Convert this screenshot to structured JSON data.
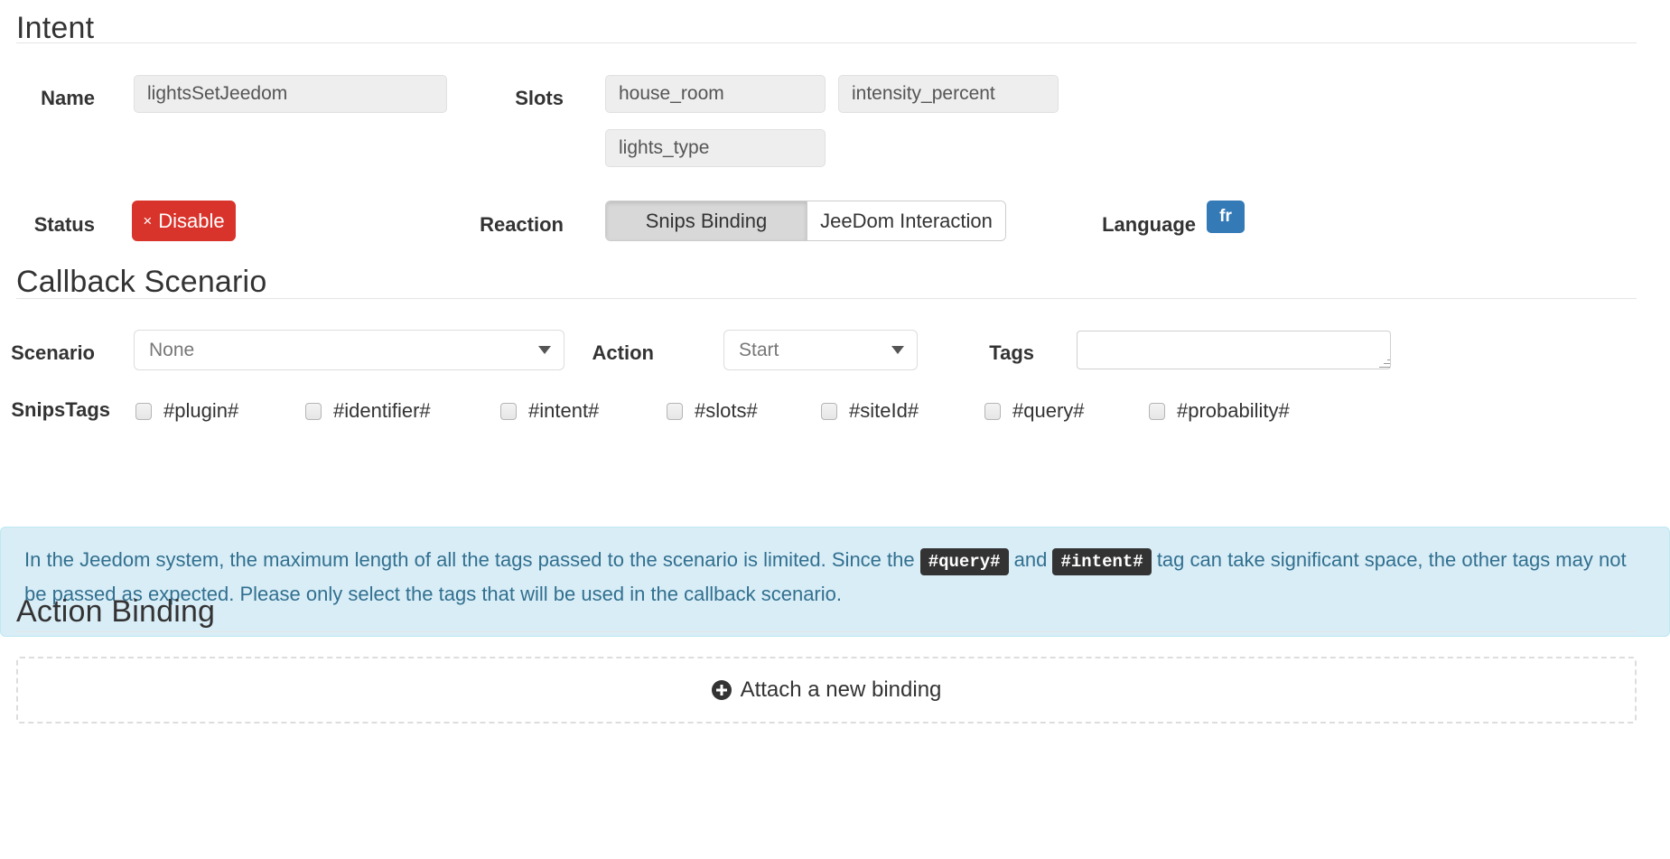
{
  "intent_section": {
    "heading": "Intent",
    "name_label": "Name",
    "name_value": "lightsSetJeedom",
    "slots_label": "Slots",
    "slots": [
      "house_room",
      "intensity_percent",
      "lights_type"
    ],
    "status_label": "Status",
    "status_button": {
      "label": "Disable",
      "icon": "×",
      "color": "#d9342b"
    },
    "reaction_label": "Reaction",
    "reaction_options": [
      "Snips Binding",
      "JeeDom Interaction"
    ],
    "reaction_selected": "Snips Binding",
    "language_label": "Language",
    "language_badge": {
      "text": "fr",
      "color": "#337ab7"
    }
  },
  "callback_section": {
    "heading": "Callback Scenario",
    "scenario_label": "Scenario",
    "scenario_value": "None",
    "action_label": "Action",
    "action_value": "Start",
    "tags_label": "Tags",
    "tags_value": "",
    "tags_placeholder": "",
    "snipstags_label": "SnipsTags",
    "snipstags": [
      {
        "label": "#plugin#",
        "checked": false
      },
      {
        "label": "#identifier#",
        "checked": false
      },
      {
        "label": "#intent#",
        "checked": false
      },
      {
        "label": "#slots#",
        "checked": false
      },
      {
        "label": "#siteId#",
        "checked": false
      },
      {
        "label": "#query#",
        "checked": false
      },
      {
        "label": "#probability#",
        "checked": false
      }
    ],
    "alert": {
      "part1": "In the Jeedom system, the maximum length of all the tags passed to the scenario is limited. Since the ",
      "code1": "#query#",
      "part2": " and ",
      "code2": "#intent#",
      "part3": " tag can take significant space, the other tags may not be passed as expected. Please only select the tags that will be used in the callback scenario.",
      "bg_color": "#d9edf7",
      "text_color": "#31708f"
    }
  },
  "action_binding_section": {
    "heading": "Action Binding",
    "attach_label": "Attach a new binding",
    "attach_icon": "plus-circle-icon"
  }
}
